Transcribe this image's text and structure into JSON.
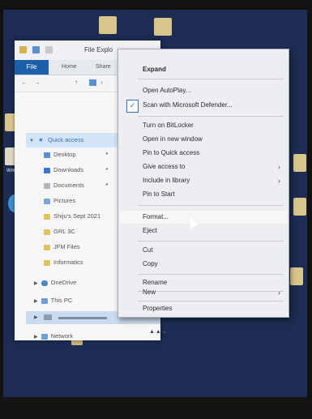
{
  "explorer": {
    "title": "File Explo",
    "tabs": [
      "File",
      "Home",
      "Share"
    ],
    "nav": [
      "Quick access",
      "Desktop",
      "Downloads",
      "Documents",
      "Pictures",
      "Shiju's Sept 2021",
      "GRL 3C",
      "JFM Files",
      "Informatics",
      "OneDrive",
      "This PC",
      "Network"
    ],
    "sidebar_partial": "Wm"
  },
  "context_menu": {
    "items": [
      {
        "label": "Expand",
        "bold": true
      },
      {
        "label": "Open AutoPlay..."
      },
      {
        "label": "Scan with Microsoft Defender...",
        "icon": "defender-icon"
      },
      {
        "label": "Turn on BitLocker"
      },
      {
        "label": "Open in new window"
      },
      {
        "label": "Pin to Quick access"
      },
      {
        "label": "Give access to",
        "submenu": true
      },
      {
        "label": "Include in library",
        "submenu": true
      },
      {
        "label": "Pin to Start"
      },
      {
        "label": "Format..."
      },
      {
        "label": "Eject"
      },
      {
        "label": "Cut"
      },
      {
        "label": "Copy"
      },
      {
        "label": "Rename"
      },
      {
        "label": "New",
        "submenu": true
      },
      {
        "label": "Properties"
      }
    ],
    "hovered": "Format..."
  },
  "colors": {
    "file_tab": "#1d5fa8",
    "desktop": "#1c2c52",
    "menu_bg": "#eceef1"
  }
}
